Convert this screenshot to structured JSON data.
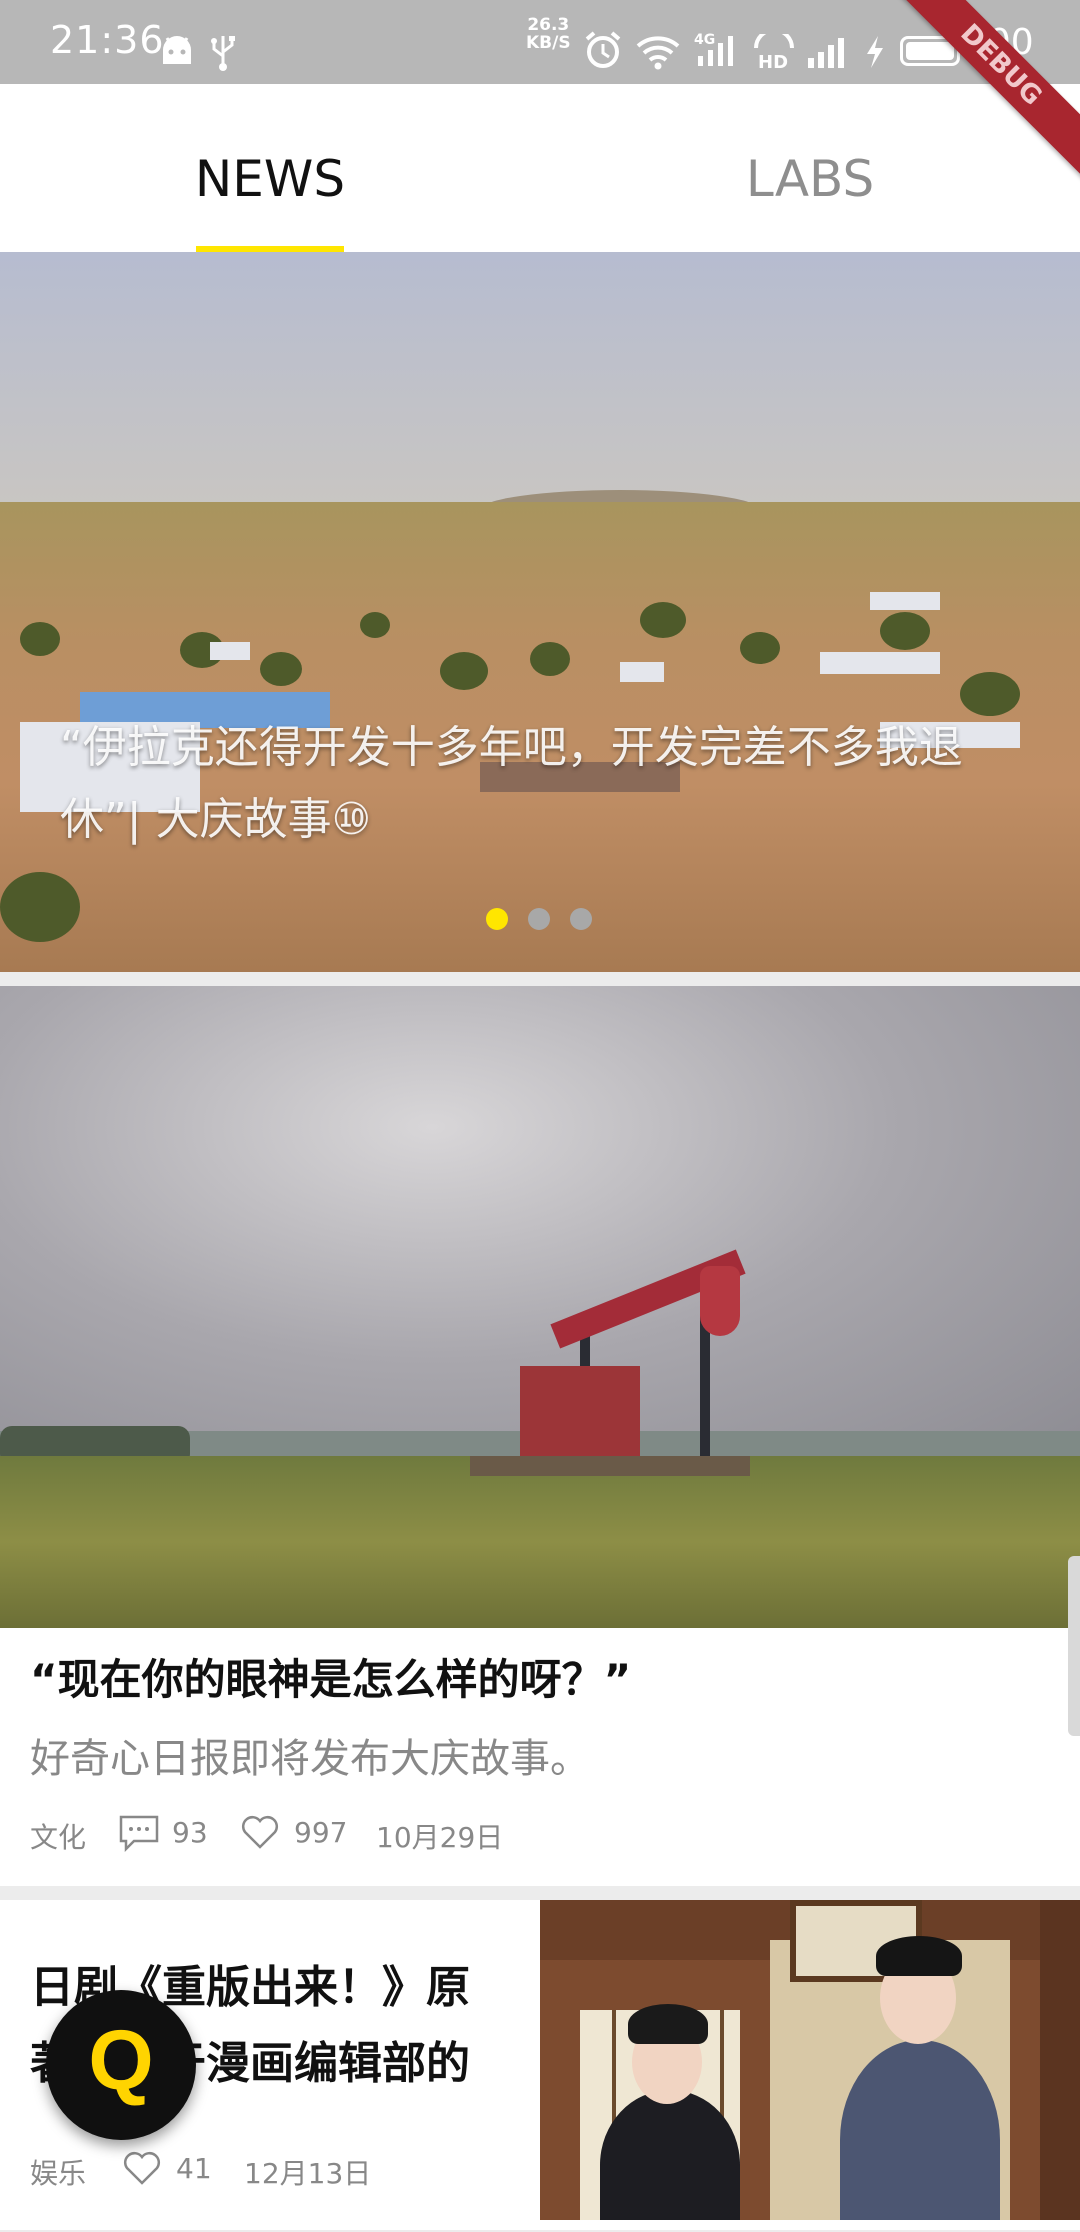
{
  "status_bar": {
    "time": "21:36",
    "net_speed_value": "26.3",
    "net_speed_unit": "KB/S",
    "network_type": "4G",
    "hd_label": "HD",
    "battery": "100",
    "icons": [
      "android-icon",
      "usb-icon",
      "alarm-icon",
      "wifi-icon",
      "signal-icon",
      "hd-icon",
      "charging-icon",
      "battery-icon"
    ]
  },
  "debug_banner": "DEBUG",
  "tabs": [
    {
      "label": "NEWS",
      "active": true
    },
    {
      "label": "LABS",
      "active": false
    }
  ],
  "hero": {
    "title": "“伊拉克还得开发十多年吧，开发完差不多我退休”| 大庆故事⑩",
    "page_count": 3,
    "active_page": 0
  },
  "articles": [
    {
      "title": "“现在你的眼神是怎么样的呀？”",
      "subtitle": "好奇心日报即将发布大庆故事。",
      "category": "文化",
      "comments": "93",
      "likes": "997",
      "date": "10月29日"
    },
    {
      "title": "日剧《重版出来！》原著，关于漫画编辑部的",
      "category": "娱乐",
      "likes": "41",
      "date": "12月13日"
    }
  ],
  "fab": {
    "label": "Q"
  },
  "colors": {
    "accent": "#ffe600",
    "fab_bg": "#101010",
    "fab_text": "#ffd400",
    "status_bar": "#b7b7b7"
  }
}
